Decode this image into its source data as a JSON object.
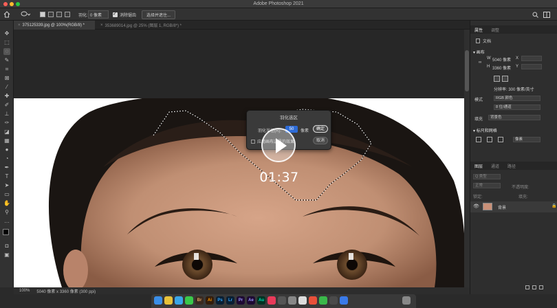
{
  "app_title": "Adobe Photoshop 2021",
  "options_bar": {
    "feather_label": "羽化:",
    "feather_value": "0 像素",
    "antialias_label": "消除锯齿",
    "select_mask_button": "选择并遮住..."
  },
  "tabs": [
    {
      "label": "375125339.jpg @ 100%(RGB/8) *"
    },
    {
      "label": "353689014.jpg @ 25% (图层 1, RGB/8*) *"
    }
  ],
  "status": {
    "zoom": "100%",
    "info": "5040 像素 x 3360 像素 (300 ppi)"
  },
  "dialog": {
    "title": "羽化选区",
    "radius_label": "羽化半径(R):",
    "radius_value": "50",
    "unit": "像素",
    "apply_label": "应用画布边界的效果",
    "ok_button": "确定",
    "cancel_button": "取消"
  },
  "video": {
    "timer": "01:37"
  },
  "panels": {
    "properties_tabs": [
      "属性",
      "调整"
    ],
    "document_label": "文档",
    "canvas_section": "画布",
    "width_label": "W",
    "width_value": "5040 像素",
    "height_label": "H",
    "height_value": "3360 像素",
    "x_label": "X",
    "y_label": "Y",
    "resolution": "分辨率: 300 像素/英寸",
    "mode_label": "模式",
    "mode_value": "RGB 颜色",
    "depth_value": "8 位/通道",
    "fill_label": "填充",
    "fill_value": "背景色",
    "rulers_section": "标尺和网格",
    "rulers_unit": "像素",
    "layers_tabs": [
      "图层",
      "通道",
      "路径"
    ],
    "layers_search": "Q 类型",
    "blend_mode": "正常",
    "opacity_label": "不透明度:",
    "lock_label": "锁定:",
    "fill_short": "填充:",
    "layer_name": "背景"
  },
  "dock_apps": [
    "Finder",
    "Chrome",
    "Safari",
    "Messages",
    "Bridge",
    "Illustrator",
    "Photoshop",
    "Lightroom",
    "Premiere",
    "After Effects",
    "Audition",
    "Music",
    "Motion",
    "Camera",
    "Preview",
    "Numbers",
    "Calendar",
    "QuickTime",
    "Keynote",
    "Trash"
  ],
  "colors": {
    "accent": "#2d6bd6",
    "ui_dark": "#2e2e2e"
  }
}
